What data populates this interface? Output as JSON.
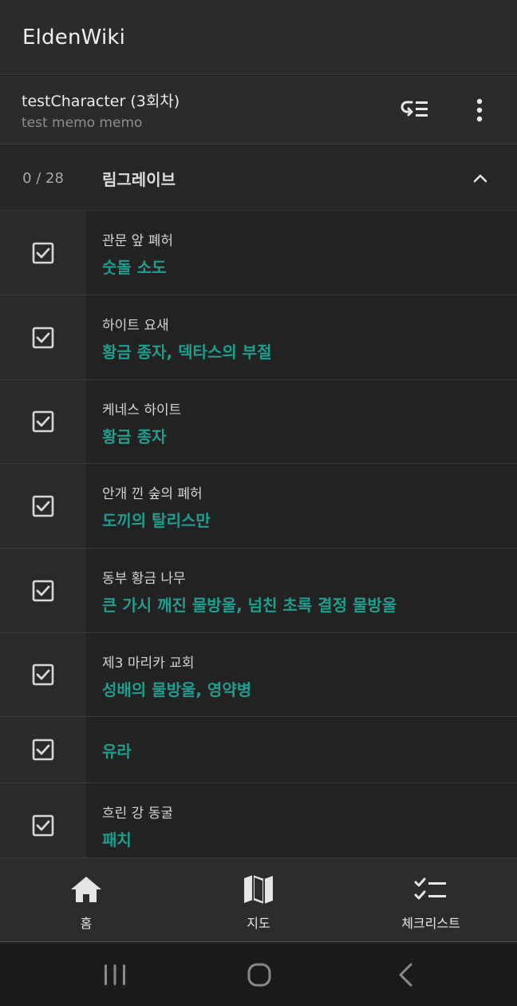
{
  "app": {
    "title": "EldenWiki"
  },
  "character": {
    "name": "testCharacter (3회차)",
    "memo": "test memo memo",
    "sort_icon": "sort-list-icon",
    "more_icon": "more-vert-icon"
  },
  "section": {
    "count": "0 / 28",
    "title": "림그레이브",
    "toggle_icon": "chevron-up-icon"
  },
  "items": [
    {
      "location": "관문 앞 폐허",
      "item": "숫돌 소도",
      "checked": true
    },
    {
      "location": "하이트 요새",
      "item": "황금 종자, 덱타스의 부절",
      "checked": true
    },
    {
      "location": "케네스 하이트",
      "item": "황금 종자",
      "checked": true
    },
    {
      "location": "안개 낀 숲의 폐허",
      "item": "도끼의 탈리스만",
      "checked": true
    },
    {
      "location": "동부 황금 나무",
      "item": "큰 가시 깨진 물방울, 넘친 초록 결정 물방울",
      "checked": true
    },
    {
      "location": "제3 마리카 교회",
      "item": "성배의 물방울, 영약병",
      "checked": true
    },
    {
      "location": "",
      "item": "유라",
      "checked": true
    },
    {
      "location": "흐린 강 동굴",
      "item": "패치",
      "checked": true
    }
  ],
  "nav": {
    "home": {
      "label": "홈",
      "icon": "home-icon"
    },
    "map": {
      "label": "지도",
      "icon": "map-icon"
    },
    "checklist": {
      "label": "체크리스트",
      "icon": "checklist-icon"
    }
  },
  "system": {
    "recents": "recents-icon",
    "home": "home-circle-icon",
    "back": "back-icon"
  },
  "colors": {
    "accent": "#1f9e8f",
    "background": "#222222",
    "bar": "#2b2b2b"
  }
}
